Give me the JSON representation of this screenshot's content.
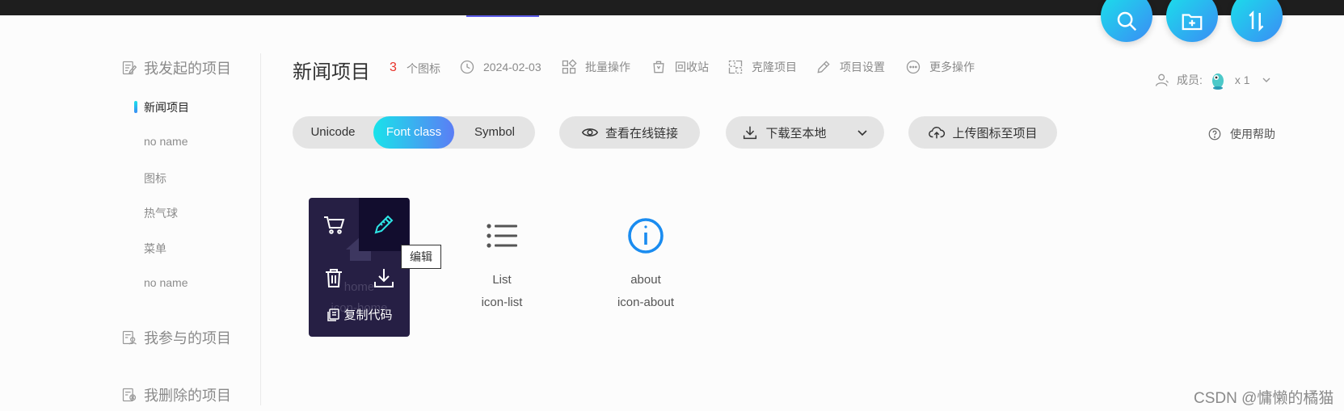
{
  "sidebar": {
    "my_projects_label": "我发起的项目",
    "projects": [
      {
        "label": "新闻项目",
        "active": true
      },
      {
        "label": "no name"
      },
      {
        "label": "图标"
      },
      {
        "label": "热气球"
      },
      {
        "label": "菜单"
      },
      {
        "label": "no name"
      }
    ],
    "joined_projects_label": "我参与的项目",
    "deleted_projects_label": "我删除的项目"
  },
  "header": {
    "title": "新闻项目",
    "icon_count": "3",
    "icon_count_label": "个图标",
    "date": "2024-02-03",
    "batch_label": "批量操作",
    "recycle_label": "回收站",
    "clone_label": "克隆项目",
    "settings_label": "项目设置",
    "more_label": "更多操作",
    "members_label": "成员:",
    "members_count": "x 1"
  },
  "toolbar": {
    "modes": [
      "Unicode",
      "Font class",
      "Symbol"
    ],
    "selected_mode": "Font class",
    "view_online_label": "查看在线链接",
    "download_label": "下载至本地",
    "upload_label": "上传图标至项目",
    "help_label": "使用帮助"
  },
  "icons": [
    {
      "name": "home",
      "class": "icon-home",
      "icon": "home-icon"
    },
    {
      "name": "List",
      "class": "icon-list",
      "icon": "list-icon"
    },
    {
      "name": "about",
      "class": "icon-about",
      "icon": "info-icon",
      "color": "#1a8cf0"
    }
  ],
  "hover_menu": {
    "copy_code_label": "复制代码",
    "tooltip": "编辑"
  },
  "colors": {
    "accent_gradient_start": "#19e3ea",
    "accent_gradient_end": "#3b8cf5",
    "count_red": "#e8322a",
    "hover_card_bg": "#261f44"
  },
  "watermark": "CSDN @慵懒的橘猫"
}
